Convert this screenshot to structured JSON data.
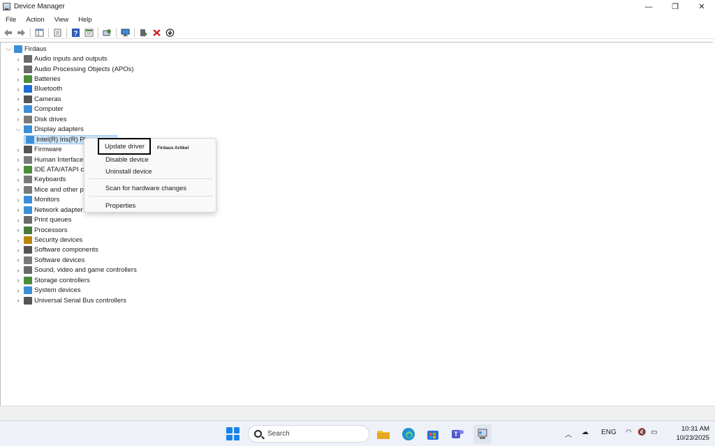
{
  "window": {
    "title": "Device Manager",
    "controls": {
      "minimize": "—",
      "restore": "❐",
      "close": "✕"
    }
  },
  "menu": [
    "File",
    "Action",
    "View",
    "Help"
  ],
  "toolbar": {
    "icons": [
      "back-arrow-icon",
      "forward-arrow-icon",
      "show-hide-console-tree-icon",
      "properties-icon",
      "help-icon",
      "view-icon",
      "scan-hardware-icon",
      "monitor-icon",
      "update-driver-icon",
      "uninstall-icon",
      "download-icon"
    ]
  },
  "tree": {
    "root": "Firdaus",
    "categories": [
      {
        "label": "Audio inputs and outputs",
        "icon": "speaker-icon",
        "color": "#6a6a6a"
      },
      {
        "label": "Audio Processing Objects (APOs)",
        "icon": "speaker-icon",
        "color": "#6a6a6a"
      },
      {
        "label": "Batteries",
        "icon": "battery-icon",
        "color": "#4a8c3a"
      },
      {
        "label": "Bluetooth",
        "icon": "bluetooth-icon",
        "color": "#1c6ed6"
      },
      {
        "label": "Cameras",
        "icon": "camera-icon",
        "color": "#555555"
      },
      {
        "label": "Computer",
        "icon": "computer-icon",
        "color": "#3b8fd9"
      },
      {
        "label": "Disk drives",
        "icon": "disk-drive-icon",
        "color": "#7a7a7a"
      },
      {
        "label": "Display adapters",
        "icon": "display-adapter-icon",
        "color": "#3b8fd9",
        "expanded": true
      }
    ],
    "child": "Intel(R) Iris(R) Plus Graphics",
    "child_visible": "Intel(R) Iris(R) Pl",
    "categories_after": [
      {
        "label": "Firmware",
        "icon": "firmware-icon",
        "color": "#555555"
      },
      {
        "label": "Human Interface",
        "icon": "hid-icon",
        "color": "#7a7a7a"
      },
      {
        "label": "IDE ATA/ATAPI co",
        "icon": "ide-icon",
        "color": "#4a8c3a"
      },
      {
        "label": "Keyboards",
        "icon": "keyboard-icon",
        "color": "#7a7a7a"
      },
      {
        "label": "Mice and other p",
        "icon": "mouse-icon",
        "color": "#7a7a7a"
      },
      {
        "label": "Monitors",
        "icon": "monitor-icon",
        "color": "#3b8fd9"
      },
      {
        "label": "Network adapter",
        "icon": "network-adapter-icon",
        "color": "#3b8fd9"
      },
      {
        "label": "Print queues",
        "icon": "printer-icon",
        "color": "#6a6a6a"
      },
      {
        "label": "Processors",
        "icon": "processor-icon",
        "color": "#4a7a3a"
      },
      {
        "label": "Security devices",
        "icon": "security-device-icon",
        "color": "#b8860b"
      },
      {
        "label": "Software components",
        "icon": "software-component-icon",
        "color": "#555555"
      },
      {
        "label": "Software devices",
        "icon": "software-device-icon",
        "color": "#7a7a7a"
      },
      {
        "label": "Sound, video and game controllers",
        "icon": "sound-icon",
        "color": "#6a6a6a"
      },
      {
        "label": "Storage controllers",
        "icon": "storage-controller-icon",
        "color": "#4a8c3a"
      },
      {
        "label": "System devices",
        "icon": "system-device-icon",
        "color": "#3b8fd9"
      },
      {
        "label": "Universal Serial Bus controllers",
        "icon": "usb-icon",
        "color": "#555555"
      }
    ]
  },
  "context_menu": {
    "update": "Update driver",
    "disable": "Disable device",
    "uninstall": "Uninstall device",
    "scan": "Scan for hardware changes",
    "properties": "Properties"
  },
  "watermark": "Firdaus Artikel",
  "taskbar": {
    "search_placeholder": "Search",
    "language": "ENG",
    "time": "10:31 AM",
    "date": "10/23/2025"
  }
}
